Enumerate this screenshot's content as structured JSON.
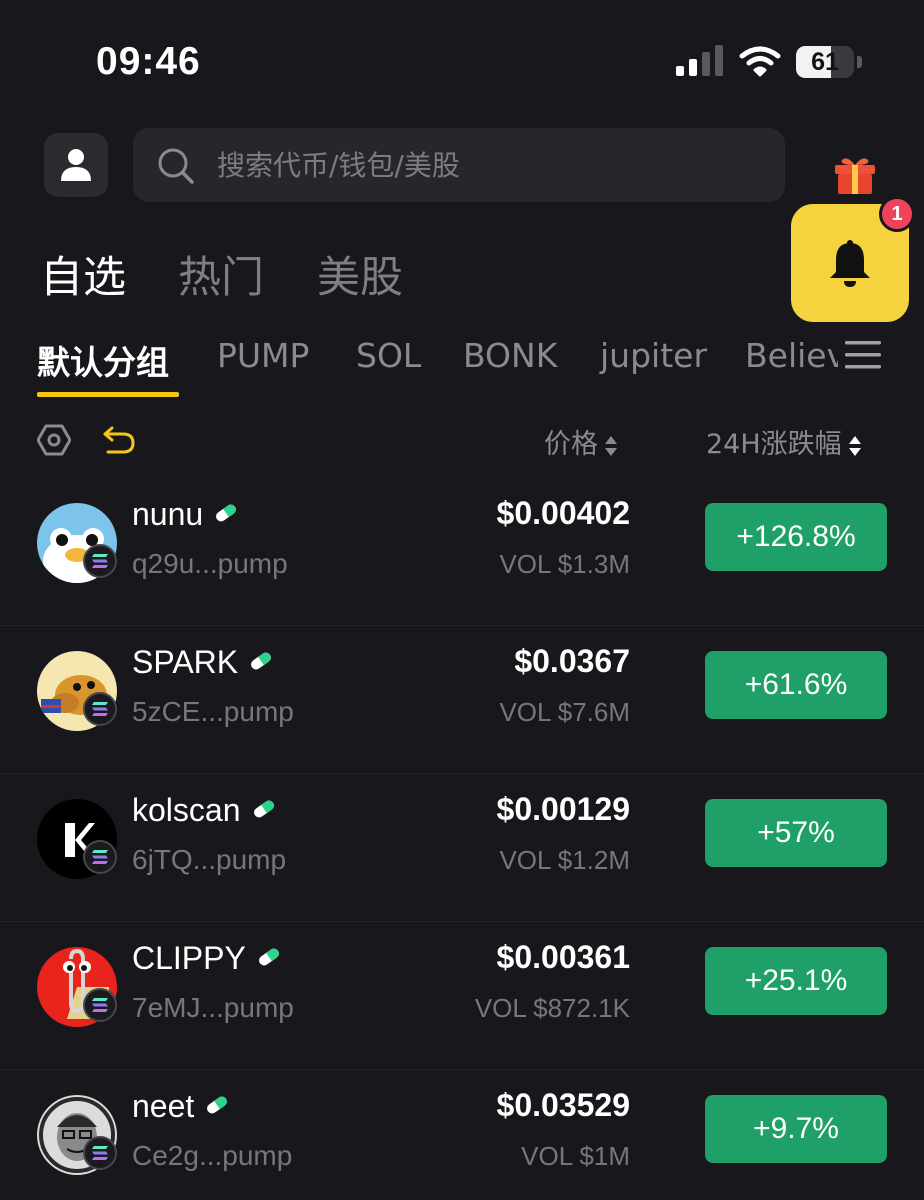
{
  "status_bar": {
    "time": "09:46",
    "battery": "61",
    "battery_level": 0.61
  },
  "search": {
    "placeholder": "搜索代币/钱包/美股"
  },
  "notifications": {
    "badge_count": "1"
  },
  "main_tabs": [
    {
      "label": "自选",
      "active": true
    },
    {
      "label": "热门",
      "active": false
    },
    {
      "label": "美股",
      "active": false
    }
  ],
  "group_tabs": [
    {
      "label": "默认分组",
      "active": true
    },
    {
      "label": "PUMP",
      "active": false
    },
    {
      "label": "SOL",
      "active": false
    },
    {
      "label": "BONK",
      "active": false
    },
    {
      "label": "jupiter",
      "active": false
    },
    {
      "label": "Believ",
      "active": false
    }
  ],
  "columns": {
    "price": "价格",
    "change": "24H涨跌幅"
  },
  "tokens": [
    {
      "name": "nunu",
      "address": "q29u...pump",
      "price": "$0.00402",
      "volume": "VOL $1.3M",
      "change": "+126.8%"
    },
    {
      "name": "SPARK",
      "address": "5zCE...pump",
      "price": "$0.0367",
      "volume": "VOL $7.6M",
      "change": "+61.6%"
    },
    {
      "name": "kolscan",
      "address": "6jTQ...pump",
      "price": "$0.00129",
      "volume": "VOL $1.2M",
      "change": "+57%"
    },
    {
      "name": "CLIPPY",
      "address": "7eMJ...pump",
      "price": "$0.00361",
      "volume": "VOL $872.1K",
      "change": "+25.1%"
    },
    {
      "name": "neet",
      "address": "Ce2g...pump",
      "price": "$0.03529",
      "volume": "VOL $1M",
      "change": "+9.7%"
    }
  ],
  "colors": {
    "background": "#18181c",
    "accent_yellow": "#f5c518",
    "notification_yellow": "#f5d33e",
    "positive_green": "#1ea068",
    "badge_red": "#f0435b"
  },
  "icons": [
    "user-icon",
    "search-icon",
    "gift-icon",
    "bell-icon",
    "menu-icon",
    "settings-icon",
    "undo-icon",
    "sort-icon",
    "pill-icon",
    "solana-icon"
  ]
}
